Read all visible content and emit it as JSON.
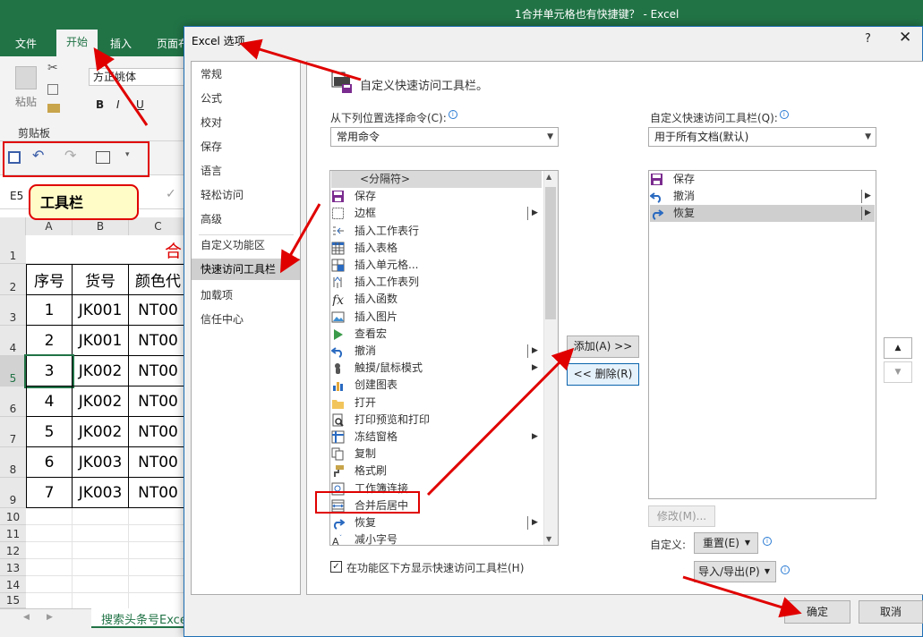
{
  "window": {
    "title": "1合并单元格也有快捷键？ - Excel",
    "tabs": [
      "文件",
      "开始",
      "插入",
      "页面布"
    ]
  },
  "ribbon": {
    "font_name": "方正姚体",
    "paste_label": "粘贴",
    "clipboard_group": "剪贴板",
    "bold": "B",
    "italic": "I",
    "underline": "U"
  },
  "formula_bar": {
    "name_box": "E5"
  },
  "annotation": {
    "toolbar_label": "工具栏"
  },
  "sheet": {
    "columns": [
      "A",
      "B",
      "C"
    ],
    "title_fragment": "合",
    "header_row": [
      "序号",
      "货号",
      "颜色代"
    ],
    "rows": [
      [
        "1",
        "JK001",
        "NT00"
      ],
      [
        "2",
        "JK001",
        "NT00"
      ],
      [
        "3",
        "JK002",
        "NT00"
      ],
      [
        "4",
        "JK002",
        "NT00"
      ],
      [
        "5",
        "JK002",
        "NT00"
      ],
      [
        "6",
        "JK003",
        "NT00"
      ],
      [
        "7",
        "JK003",
        "NT00"
      ]
    ],
    "row_numbers": [
      "1",
      "2",
      "3",
      "4",
      "5",
      "6",
      "7",
      "8",
      "9",
      "10",
      "11",
      "12",
      "13",
      "14",
      "15"
    ],
    "tab_name": "搜索头条号Excel"
  },
  "dialog": {
    "title": "Excel 选项",
    "help": "?",
    "close": "✕",
    "nav": [
      "常规",
      "公式",
      "校对",
      "保存",
      "语言",
      "轻松访问",
      "高级",
      "自定义功能区",
      "快速访问工具栏",
      "加载项",
      "信任中心"
    ],
    "selected_nav": "快速访问工具栏",
    "heading": "自定义快速访问工具栏。",
    "choose_from_label": "从下列位置选择命令(C):",
    "choose_from_value": "常用命令",
    "customize_label": "自定义快速访问工具栏(Q):",
    "customize_value": "用于所有文档(默认)",
    "commands": [
      {
        "label": "<分隔符>",
        "icon": "separator-icon",
        "submenu": false
      },
      {
        "label": "保存",
        "icon": "save-icon",
        "submenu": false
      },
      {
        "label": "边框",
        "icon": "border-icon",
        "submenu": true
      },
      {
        "label": "插入工作表行",
        "icon": "insert-row-icon",
        "submenu": false
      },
      {
        "label": "插入表格",
        "icon": "insert-table-icon",
        "submenu": false
      },
      {
        "label": "插入单元格...",
        "icon": "insert-cell-icon",
        "submenu": false
      },
      {
        "label": "插入工作表列",
        "icon": "insert-column-icon",
        "submenu": false
      },
      {
        "label": "插入函数",
        "icon": "function-icon",
        "submenu": false
      },
      {
        "label": "插入图片",
        "icon": "picture-icon",
        "submenu": false
      },
      {
        "label": "查看宏",
        "icon": "macro-icon",
        "submenu": false
      },
      {
        "label": "撤消",
        "icon": "undo-icon",
        "submenu": true
      },
      {
        "label": "触摸/鼠标模式",
        "icon": "touch-icon",
        "submenu": true
      },
      {
        "label": "创建图表",
        "icon": "chart-icon",
        "submenu": false
      },
      {
        "label": "打开",
        "icon": "open-folder-icon",
        "submenu": false
      },
      {
        "label": "打印预览和打印",
        "icon": "print-preview-icon",
        "submenu": false
      },
      {
        "label": "冻结窗格",
        "icon": "freeze-icon",
        "submenu": true
      },
      {
        "label": "复制",
        "icon": "copy-icon",
        "submenu": false
      },
      {
        "label": "格式刷",
        "icon": "format-painter-icon",
        "submenu": false
      },
      {
        "label": "工作簿连接",
        "icon": "connection-icon",
        "submenu": false
      },
      {
        "label": "合并后居中",
        "icon": "merge-center-icon",
        "submenu": false
      },
      {
        "label": "恢复",
        "icon": "redo-icon",
        "submenu": true
      },
      {
        "label": "减小字号",
        "icon": "decrease-font-icon",
        "submenu": false
      }
    ],
    "qat_items": [
      {
        "label": "保存",
        "icon": "save-icon",
        "submenu": false
      },
      {
        "label": "撤消",
        "icon": "undo-icon",
        "submenu": true
      },
      {
        "label": "恢复",
        "icon": "redo-icon",
        "submenu": true
      }
    ],
    "add_button": "添加(A) >>",
    "remove_button": "<< 删除(R)",
    "modify_button": "修改(M)...",
    "customize_label2": "自定义:",
    "reset_button": "重置(E)",
    "import_export_button": "导入/导出(P)",
    "show_below_checkbox": "在功能区下方显示快速访问工具栏(H)",
    "ok_button": "确定",
    "cancel_button": "取消"
  },
  "colors": {
    "excel_green": "#217346",
    "annotation_red": "#e00000",
    "selected_gray": "#cfcfcf",
    "title_red": "#e00000"
  }
}
